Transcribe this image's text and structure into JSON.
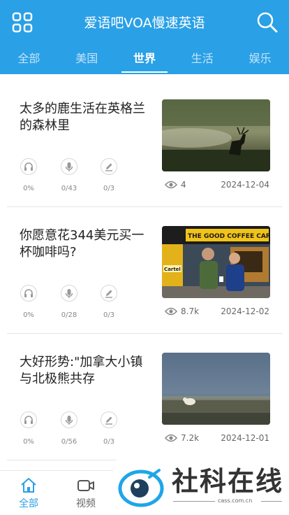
{
  "header": {
    "title": "爱语吧VOA慢速英语",
    "menu_icon": "grid-icon",
    "search_icon": "search-icon",
    "background": "#2aa0e6"
  },
  "tabs": [
    {
      "label": "全部",
      "active": false
    },
    {
      "label": "美国",
      "active": false
    },
    {
      "label": "世界",
      "active": true
    },
    {
      "label": "生活",
      "active": false
    },
    {
      "label": "娱乐",
      "active": false
    }
  ],
  "articles": [
    {
      "title": "太多的鹿生活在英格兰的森林里",
      "image": "deer-in-misty-forest",
      "listen_count": "0%",
      "record_count": "0/43",
      "write_count": "0/3",
      "views": "4",
      "date": "2024-12-04"
    },
    {
      "title": "你愿意花344美元买一杯咖啡吗?",
      "image": "coffee-cart-shop",
      "listen_count": "0%",
      "record_count": "0/28",
      "write_count": "0/3",
      "views": "8.7k",
      "date": "2024-12-02"
    },
    {
      "title": "大好形势:\"加拿大小镇与北极熊共存",
      "image": "polar-bear-on-tundra",
      "listen_count": "0%",
      "record_count": "0/56",
      "write_count": "0/3",
      "views": "7.2k",
      "date": "2024-12-01"
    }
  ],
  "thumb_signs": {
    "coffee_banner": "THE GOOD COFFEE CARTE",
    "coffee_side": "Cartel"
  },
  "bottom_nav": [
    {
      "label": "全部",
      "icon": "home-icon",
      "active": true
    },
    {
      "label": "视频",
      "icon": "video-icon",
      "active": false
    }
  ],
  "watermark": {
    "text": "社科在线",
    "url": "cass.com.cn"
  },
  "colors": {
    "accent": "#2aa0e6",
    "text_primary": "#222222",
    "text_secondary": "#888888"
  }
}
